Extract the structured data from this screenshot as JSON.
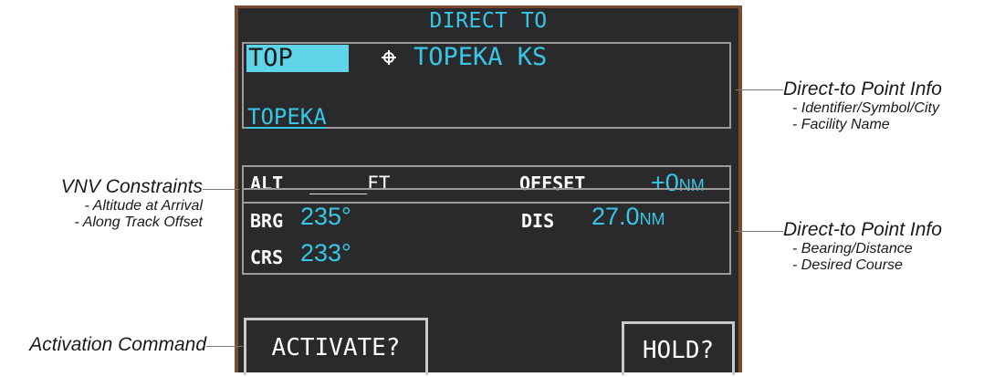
{
  "page": {
    "title": "DIRECT TO",
    "ident_field": "TOP",
    "symbol_icon": "airport-icon",
    "city": "TOPEKA KS",
    "facility_name": "TOPEKA",
    "alt_label": "ALT",
    "alt_value": "_____FT",
    "offset_label": "OFFSET",
    "offset_value": "+0",
    "offset_unit": "NM",
    "brg_label": "BRG",
    "brg_value": "235°",
    "dis_label": "DIS",
    "dis_value": "27.0",
    "dis_unit": "NM",
    "crs_label": "CRS",
    "crs_value": "233°",
    "activate_button": "ACTIVATE?",
    "hold_button": "HOLD?"
  },
  "callouts": {
    "vnv": {
      "title": "VNV Constraints",
      "lines": [
        "- Altitude at Arrival",
        "- Along Track Offset"
      ]
    },
    "activation": {
      "title": "Activation Command"
    },
    "point_info_top": {
      "title": "Direct-to Point Info",
      "lines": [
        "- Identifier/Symbol/City",
        "- Facility Name"
      ]
    },
    "point_info_bottom": {
      "title": "Direct-to Point Info",
      "lines": [
        "- Bearing/Distance",
        "- Desired Course"
      ]
    }
  },
  "colors": {
    "screen_bg": "#2a2a2c",
    "frame": "#7a4b2e",
    "cyan": "#36c8e6",
    "cursor": "#5fd4e8",
    "box_border": "#9b9b9b"
  }
}
